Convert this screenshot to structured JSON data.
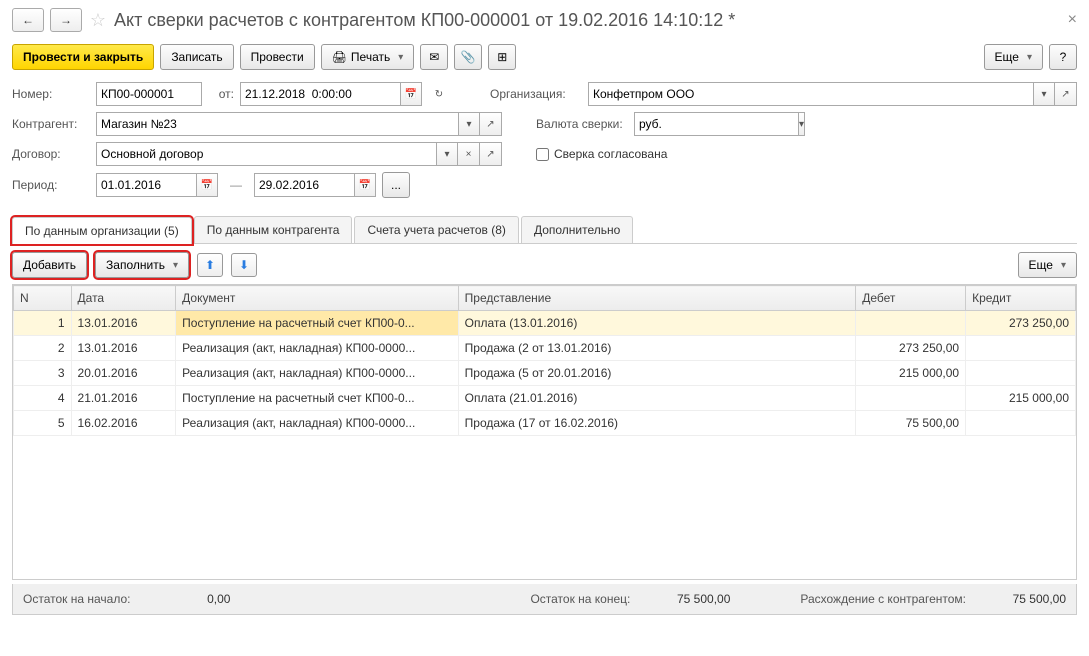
{
  "title": "Акт сверки расчетов с контрагентом КП00-000001 от 19.02.2016 14:10:12 *",
  "toolbar": {
    "post_close": "Провести и закрыть",
    "save": "Записать",
    "post": "Провести",
    "print": "Печать",
    "more": "Еще"
  },
  "form": {
    "number_label": "Номер:",
    "number": "КП00-000001",
    "from_label": "от:",
    "from_date": "21.12.2018  0:00:00",
    "org_label": "Организация:",
    "org": "Конфетпром ООО",
    "partner_label": "Контрагент:",
    "partner": "Магазин №23",
    "currency_label": "Валюта сверки:",
    "currency": "руб.",
    "contract_label": "Договор:",
    "contract": "Основной договор",
    "agree_label": "Сверка согласована",
    "period_label": "Период:",
    "period_from": "01.01.2016",
    "period_to": "29.02.2016",
    "ellipsis": "..."
  },
  "tabs": {
    "org": "По данным организации (5)",
    "partner": "По данным контрагента",
    "accounts": "Счета учета расчетов (8)",
    "extra": "Дополнительно"
  },
  "sub": {
    "add": "Добавить",
    "fill": "Заполнить",
    "more": "Еще"
  },
  "columns": {
    "n": "N",
    "date": "Дата",
    "doc": "Документ",
    "rep": "Представление",
    "debit": "Дебет",
    "credit": "Кредит"
  },
  "rows": [
    {
      "n": "1",
      "date": "13.01.2016",
      "doc": "Поступление на расчетный счет КП00-0...",
      "rep": "Оплата (13.01.2016)",
      "debit": "",
      "credit": "273 250,00"
    },
    {
      "n": "2",
      "date": "13.01.2016",
      "doc": "Реализация (акт, накладная) КП00-0000...",
      "rep": "Продажа (2 от 13.01.2016)",
      "debit": "273 250,00",
      "credit": ""
    },
    {
      "n": "3",
      "date": "20.01.2016",
      "doc": "Реализация (акт, накладная) КП00-0000...",
      "rep": "Продажа (5 от 20.01.2016)",
      "debit": "215 000,00",
      "credit": ""
    },
    {
      "n": "4",
      "date": "21.01.2016",
      "doc": "Поступление на расчетный счет КП00-0...",
      "rep": "Оплата (21.01.2016)",
      "debit": "",
      "credit": "215 000,00"
    },
    {
      "n": "5",
      "date": "16.02.2016",
      "doc": "Реализация (акт, накладная) КП00-0000...",
      "rep": "Продажа (17 от 16.02.2016)",
      "debit": "75 500,00",
      "credit": ""
    }
  ],
  "footer": {
    "start_label": "Остаток на начало:",
    "start": "0,00",
    "end_label": "Остаток на конец:",
    "end": "75 500,00",
    "diff_label": "Расхождение с контрагентом:",
    "diff": "75 500,00"
  }
}
